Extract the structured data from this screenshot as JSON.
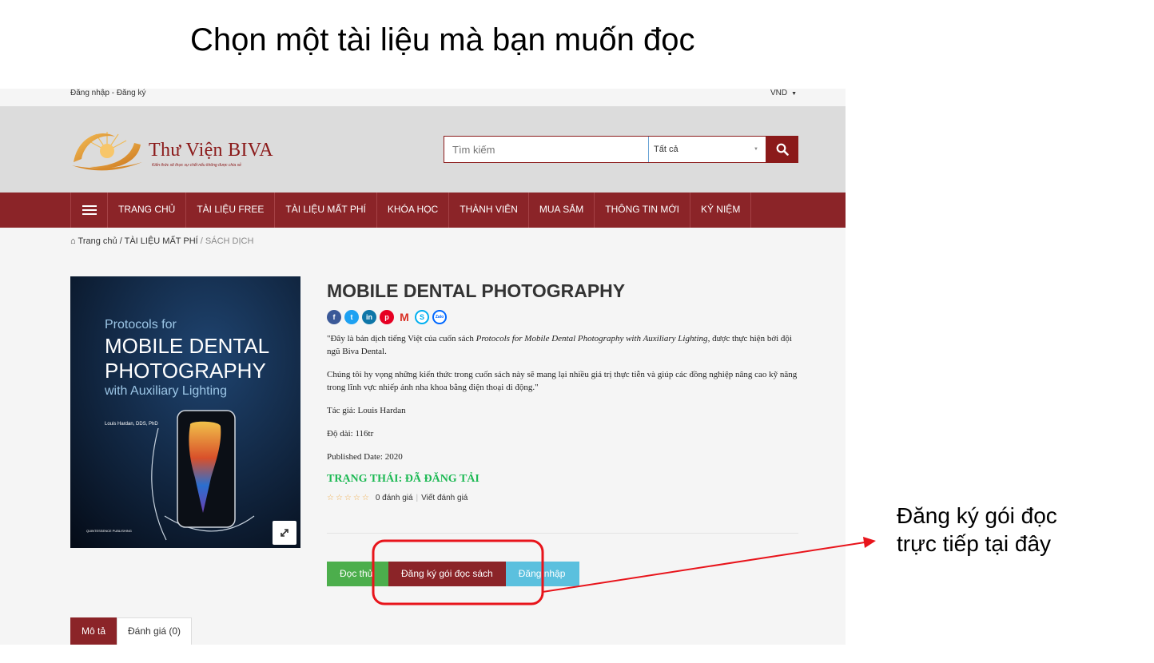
{
  "slide": {
    "title": "Chọn một tài liệu mà bạn muốn đọc",
    "note_line1": "Đăng ký gói đọc",
    "note_line2": "trực tiếp tại đây",
    "highlight_color": "#e8141b"
  },
  "topbar": {
    "login": "Đăng nhập - Đăng ký",
    "currency": "VND"
  },
  "logo": {
    "name": "Thư Viện BIVA",
    "tagline": "Kiến thức sẽ thực sự chết nếu không được chia sẻ"
  },
  "search": {
    "placeholder": "Tìm kiếm",
    "category": "Tất cả",
    "icon": "search-icon"
  },
  "nav": {
    "items": [
      "TRANG CHỦ",
      "TÀI LIỆU FREE",
      "TÀI LIỆU MẤT PHÍ",
      "KHÓA HỌC",
      "THÀNH VIÊN",
      "MUA SẮM",
      "THÔNG TIN MỚI",
      "KỶ NIỆM"
    ]
  },
  "breadcrumb": {
    "home": "Trang chủ",
    "sep": "/",
    "level1": "TÀI LIỆU MẤT PHÍ",
    "level2": "SÁCH DỊCH"
  },
  "cover": {
    "line1": "Protocols for",
    "line2": "MOBILE DENTAL",
    "line3": "PHOTOGRAPHY",
    "line4": "with Auxiliary Lighting",
    "author": "Louis Hardan, DDS, PhD",
    "publisher": "QUINTESSENCE PUBLISHING"
  },
  "product": {
    "title": "MOBILE DENTAL PHOTOGRAPHY",
    "share_icons": [
      "facebook-icon",
      "twitter-icon",
      "linkedin-icon",
      "pinterest-icon",
      "gmail-icon",
      "skype-icon",
      "zalo-icon"
    ],
    "desc1_pre": "\"Đây là bản dịch tiếng Việt của cuốn sách ",
    "desc1_italic": "Protocols for Mobile Dental Photography with Auxiliary Lighting",
    "desc1_post": ", được thực hiện bởi đội ngũ Biva Dental.",
    "desc2": "Chúng tôi hy vọng những kiến thức trong cuốn sách này sẽ mang lại nhiều giá trị thực tiễn và giúp các đồng nghiệp nâng cao kỹ năng trong lĩnh vực nhiếp ảnh nha khoa bằng điện thoại di động.\"",
    "author": "Tác giả:  Louis Hardan",
    "length": "Độ dài: 116tr",
    "published": "Published Date: 2020",
    "status": "TRẠNG THÁI: ĐÃ ĐĂNG TẢI",
    "rating_value": 0,
    "rating_text": "0 đánh giá",
    "write_review": "Viết đánh giá"
  },
  "actions": {
    "try_read": "Đọc thử",
    "register": "Đăng ký gói đọc sách",
    "login": "Đăng nhập"
  },
  "tabs": {
    "description": "Mô tả",
    "reviews": "Đánh giá (0)"
  }
}
